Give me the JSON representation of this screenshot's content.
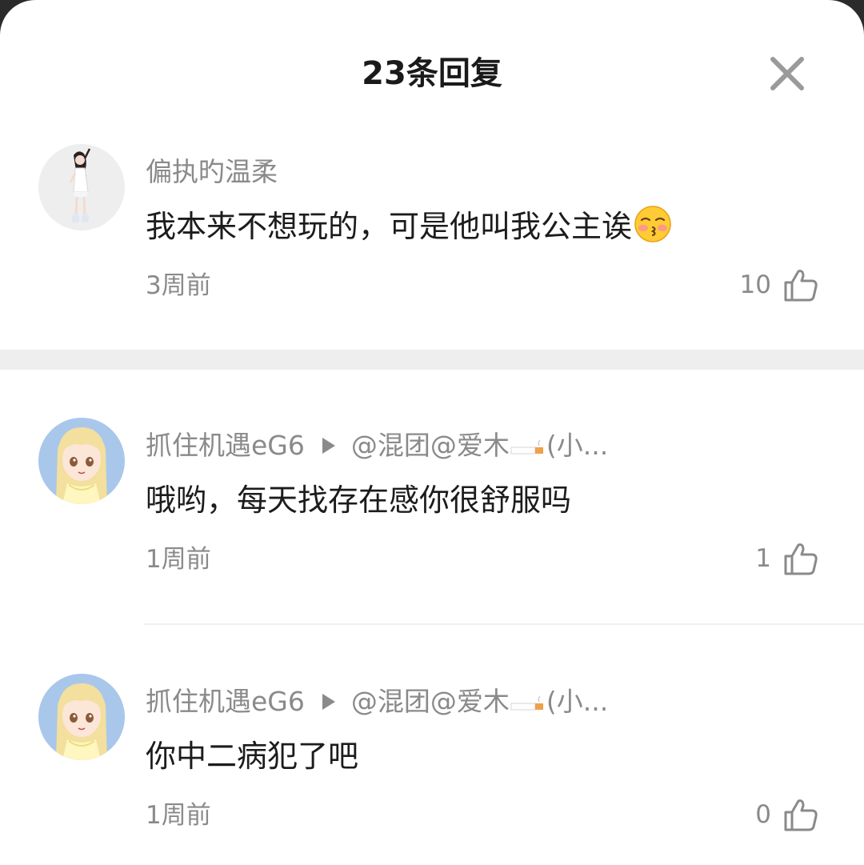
{
  "header": {
    "title": "23条回复"
  },
  "comments": [
    {
      "author": "偏执旳温柔",
      "reply_to": "",
      "content": "我本来不想玩的，可是他叫我公主诶",
      "emoji": "kissing-face-with-closed-eyes-emoji",
      "time": "3周前",
      "likes": "10"
    },
    {
      "author": "抓住机遇eG6",
      "reply_to_prefix": "@混团@爱木",
      "reply_to_suffix": "(小...",
      "content": "哦哟，每天找存在感你很舒服吗",
      "time": "1周前",
      "likes": "1"
    },
    {
      "author": "抓住机遇eG6",
      "reply_to_prefix": "@混团@爱木",
      "reply_to_suffix": "(小...",
      "content": "你中二病犯了吧",
      "time": "1周前",
      "likes": "0"
    }
  ],
  "icons": {
    "close": "close-icon",
    "like": "thumbs-up-icon",
    "reply_arrow": "play-arrow-icon",
    "cigarette": "cigarette-icon"
  },
  "colors": {
    "text_primary": "#1c1c1c",
    "text_secondary": "#8a8a8a",
    "divider": "#eeeeee",
    "background": "#ffffff"
  }
}
